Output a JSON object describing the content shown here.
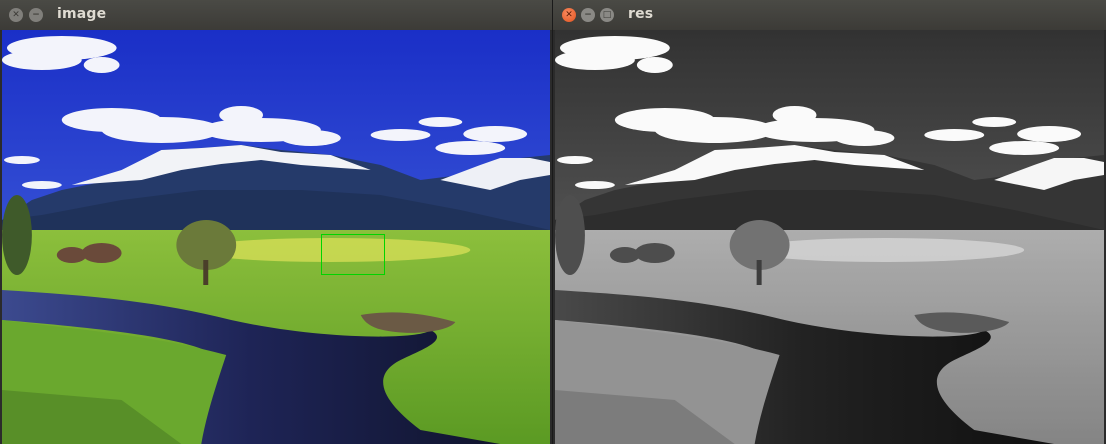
{
  "windows": {
    "left": {
      "title": "image"
    },
    "right": {
      "title": "res"
    }
  },
  "controls": {
    "close_glyph": "✕",
    "minimize_glyph": "−",
    "maximize_glyph": "□"
  },
  "icons": [
    "close-icon",
    "minimize-icon",
    "maximize-icon"
  ],
  "colors": {
    "selection_rect": "#00d400",
    "titlebar": "#3c3b37",
    "close_active": "#e2531f"
  }
}
